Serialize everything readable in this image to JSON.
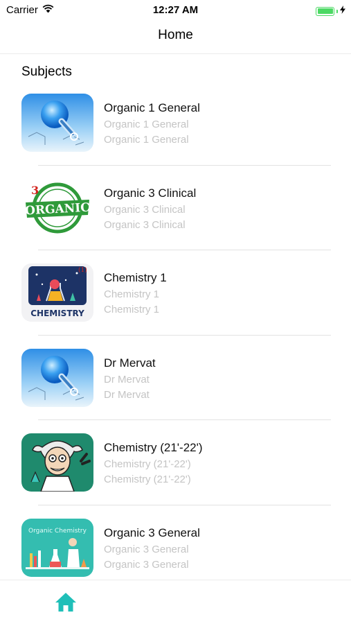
{
  "status_bar": {
    "carrier": "Carrier",
    "time": "12:27 AM",
    "battery_level": 1.0,
    "icons": [
      "wifi-icon",
      "battery-icon",
      "charging-bolt-icon"
    ]
  },
  "nav": {
    "title": "Home"
  },
  "section": {
    "title": "Subjects"
  },
  "subjects": [
    {
      "title": "Organic 1 General",
      "subtitle": "Organic 1 General",
      "detail": "Organic 1 General",
      "thumbnail": "flask-illustration"
    },
    {
      "title": "Organic 3 Clinical",
      "subtitle": "Organic 3 Clinical",
      "detail": "Organic 3 Clinical",
      "thumbnail": "organic-stamp"
    },
    {
      "title": "Chemistry 1",
      "subtitle": "Chemistry 1",
      "detail": "Chemistry 1",
      "thumbnail": "chemistry-lab",
      "thumbnail_text": "CHEMISTRY",
      "thumbnail_badge": "(1)"
    },
    {
      "title": "Dr Mervat",
      "subtitle": "Dr Mervat",
      "detail": "Dr Mervat",
      "thumbnail": "flask-illustration"
    },
    {
      "title": "Chemistry (21'-22')",
      "subtitle": "Chemistry (21'-22')",
      "detail": "Chemistry (21'-22')",
      "thumbnail": "mad-scientist"
    },
    {
      "title": "Organic 3 General",
      "subtitle": "Organic 3 General",
      "detail": "Organic 3 General",
      "thumbnail": "organic-chemistry-lab",
      "thumbnail_text": "Organic Chemistry"
    }
  ],
  "tab_bar": {
    "active_tab": "home",
    "accent": "#1fbfb8",
    "icons": [
      "home-icon"
    ]
  },
  "colors": {
    "battery": "#4cd964",
    "secondary_text": "#c4c4c4"
  }
}
